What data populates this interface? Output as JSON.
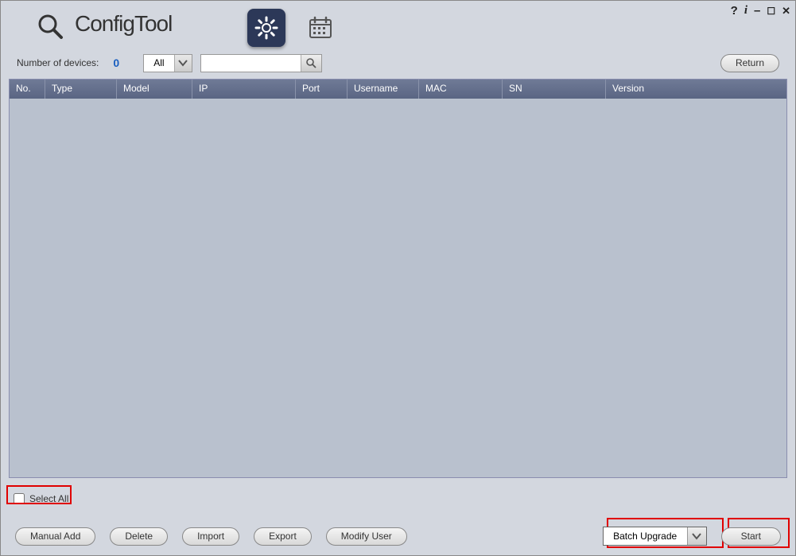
{
  "app": {
    "title": "ConfigTool"
  },
  "titlebar_icons": {
    "help": "?",
    "info": "i",
    "minimize": "–",
    "maximize": "☐",
    "close": "✕"
  },
  "filter": {
    "label": "Number of devices:",
    "count": "0",
    "dropdown": "All",
    "search_value": ""
  },
  "buttons": {
    "return": "Return",
    "select_all": "Select All",
    "manual_add": "Manual Add",
    "delete": "Delete",
    "import": "Import",
    "export": "Export",
    "modify_user": "Modify User",
    "batch_upgrade": "Batch Upgrade",
    "start": "Start"
  },
  "columns": {
    "no": "No.",
    "type": "Type",
    "model": "Model",
    "ip": "IP",
    "port": "Port",
    "username": "Username",
    "mac": "MAC",
    "sn": "SN",
    "version": "Version"
  },
  "rows": []
}
